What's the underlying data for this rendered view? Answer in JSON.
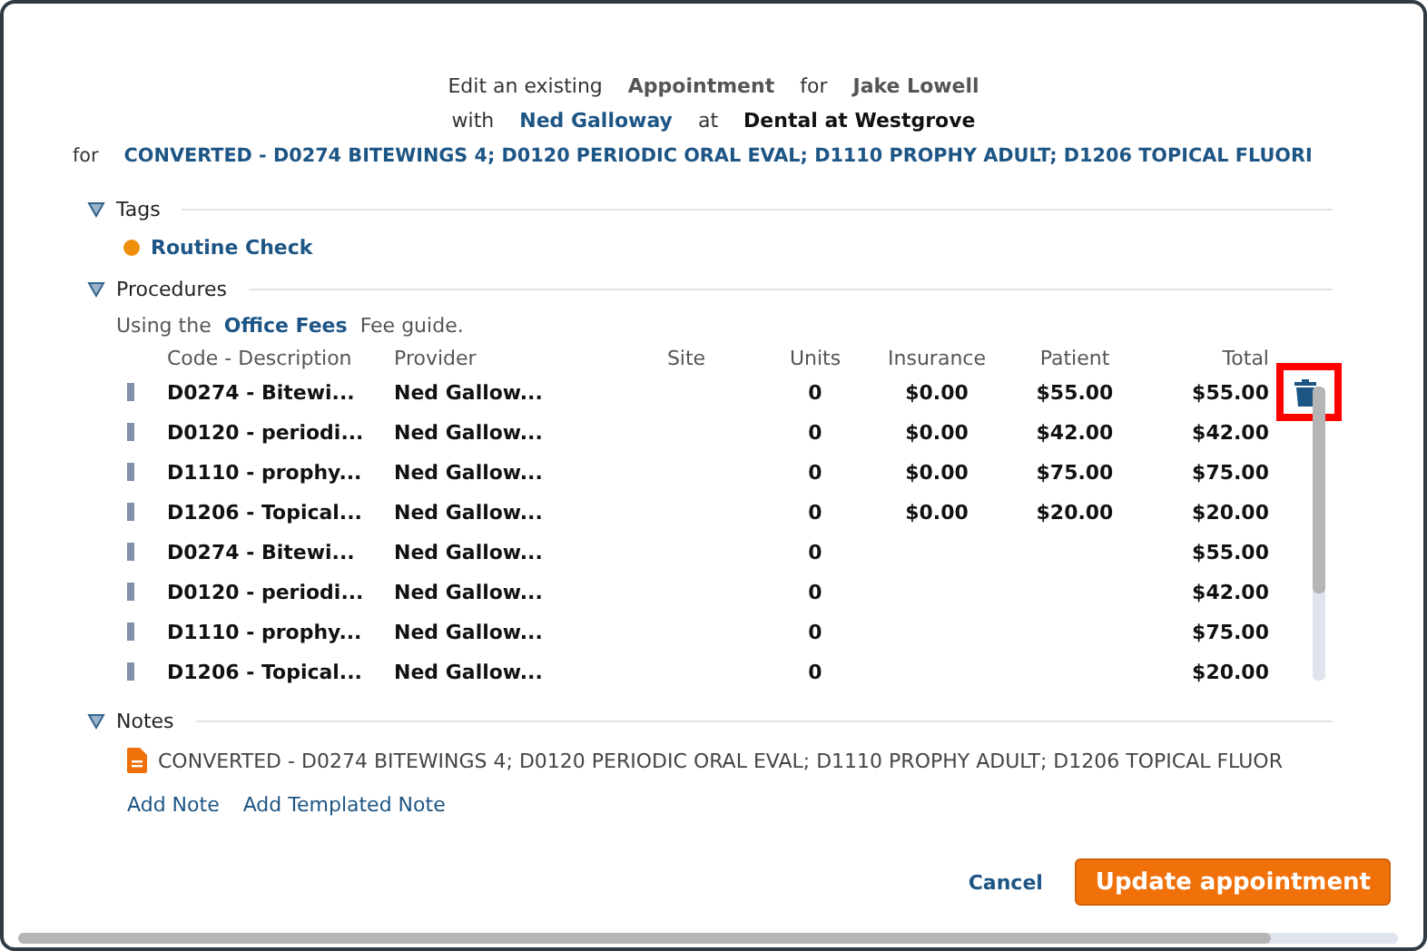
{
  "header": {
    "line1": [
      {
        "text": "Edit an existing",
        "kind": "plain"
      },
      {
        "text": "Appointment",
        "kind": "strong"
      },
      {
        "text": "for",
        "kind": "plain"
      },
      {
        "text": "Jake Lowell",
        "kind": "strong"
      }
    ],
    "line2": [
      {
        "text": "with",
        "kind": "plain"
      },
      {
        "text": "Ned Galloway",
        "kind": "link"
      },
      {
        "text": "at",
        "kind": "plain"
      },
      {
        "text": "Dental at Westgrove",
        "kind": "dark"
      }
    ],
    "line3": [
      {
        "text": "for",
        "kind": "plain"
      },
      {
        "text": "CONVERTED - D0274 BITEWINGS 4; D0120 PERIODIC ORAL EVAL; D1110 PROPHY ADULT; D1206 TOPICAL FLUORI",
        "kind": "link"
      }
    ]
  },
  "tags": {
    "title": "Tags",
    "expanded": true,
    "items": [
      {
        "label": "Routine Check",
        "color": "#f0900a"
      }
    ]
  },
  "procedures": {
    "title": "Procedures",
    "expanded": true,
    "fee_prefix": "Using the",
    "fee_guide": "Office Fees",
    "fee_suffix": "Fee guide.",
    "columns": [
      "Code - Description",
      "Provider",
      "Site",
      "Units",
      "Insurance",
      "Patient",
      "Total"
    ],
    "rows": [
      {
        "code": "D0274 - Bitewi...",
        "provider": "Ned Gallow...",
        "units": "0",
        "insurance": "$0.00",
        "patient": "$55.00",
        "total": "$55.00",
        "hovered": true
      },
      {
        "code": "D0120 - periodi...",
        "provider": "Ned Gallow...",
        "units": "0",
        "insurance": "$0.00",
        "patient": "$42.00",
        "total": "$42.00",
        "hovered": false
      },
      {
        "code": "D1110 - prophy...",
        "provider": "Ned Gallow...",
        "units": "0",
        "insurance": "$0.00",
        "patient": "$75.00",
        "total": "$75.00",
        "hovered": false
      },
      {
        "code": "D1206 - Topical...",
        "provider": "Ned Gallow...",
        "units": "0",
        "insurance": "$0.00",
        "patient": "$20.00",
        "total": "$20.00",
        "hovered": false
      },
      {
        "code": "D0274 - Bitewi...",
        "provider": "Ned Gallow...",
        "units": "0",
        "total": "$55.00",
        "hovered": false
      },
      {
        "code": "D0120 - periodi...",
        "provider": "Ned Gallow...",
        "units": "0",
        "total": "$42.00",
        "hovered": false
      },
      {
        "code": "D1110 - prophy...",
        "provider": "Ned Gallow...",
        "units": "0",
        "total": "$75.00",
        "hovered": false
      },
      {
        "code": "D1206 - Topical...",
        "provider": "Ned Gallow...",
        "units": "0",
        "total": "$20.00",
        "hovered": false
      }
    ]
  },
  "notes": {
    "title": "Notes",
    "expanded": true,
    "items": [
      {
        "text": "CONVERTED - D0274 BITEWINGS 4; D0120 PERIODIC ORAL EVAL; D1110 PROPHY ADULT; D1206 TOPICAL FLUOR"
      }
    ],
    "actions": [
      "Add Note",
      "Add Templated Note"
    ]
  },
  "footer": {
    "cancel": "Cancel",
    "submit": "Update appointment"
  }
}
